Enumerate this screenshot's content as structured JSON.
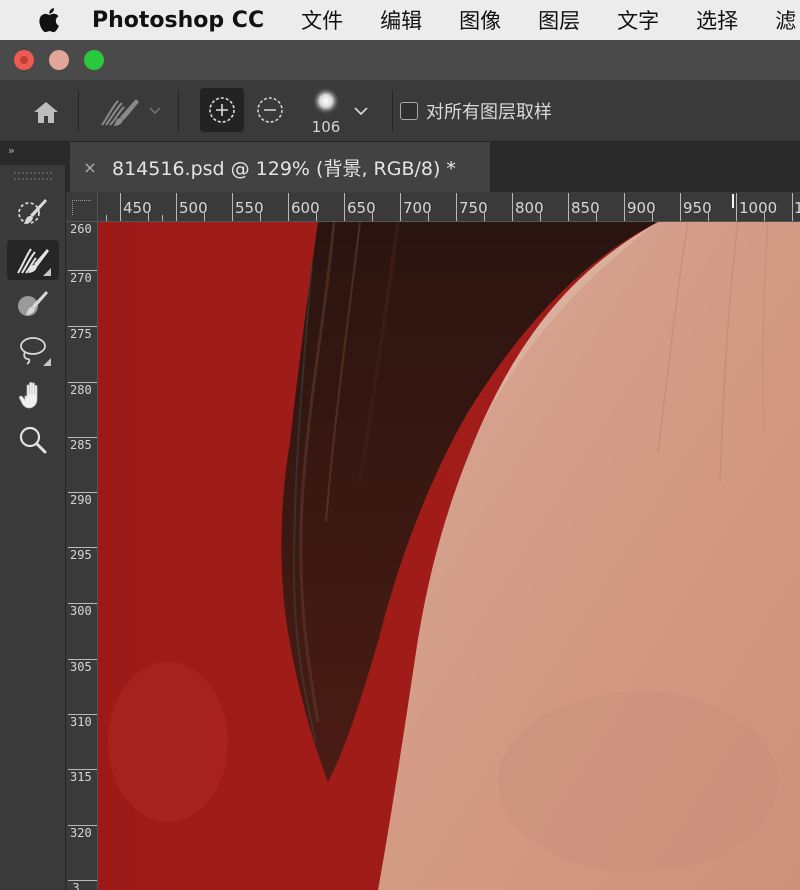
{
  "menubar": {
    "app_name": "Photoshop CC",
    "items": [
      "文件",
      "编辑",
      "图像",
      "图层",
      "文字",
      "选择",
      "滤"
    ]
  },
  "options_bar": {
    "brush_size": "106",
    "sample_all_layers_label": "对所有图层取样",
    "sample_all_layers_checked": false
  },
  "document_tab": {
    "close_glyph": "×",
    "title": "814516.psd @ 129% (背景, RGB/8) *"
  },
  "panel_collapse_glyph": "››",
  "tools": [
    {
      "name": "quick-selection-tool",
      "icon": "quick-selection-icon",
      "active": false
    },
    {
      "name": "refine-edge-brush-tool",
      "icon": "refine-edge-brush-icon",
      "active": true
    },
    {
      "name": "brush-tool",
      "icon": "brush-icon",
      "active": false
    },
    {
      "name": "lasso-tool",
      "icon": "lasso-icon",
      "active": false
    },
    {
      "name": "hand-tool",
      "icon": "hand-icon",
      "active": false
    },
    {
      "name": "zoom-tool",
      "icon": "zoom-icon",
      "active": false
    }
  ],
  "rulers": {
    "horizontal": [
      "450",
      "500",
      "550",
      "600",
      "650",
      "700",
      "750",
      "800",
      "850",
      "900",
      "950",
      "1000",
      "1"
    ],
    "vertical": [
      "260",
      "270",
      "275",
      "280",
      "285",
      "290",
      "295",
      "300",
      "305",
      "310",
      "315",
      "320",
      "3"
    ]
  },
  "colors": {
    "overlay_red": "#9b1a17",
    "skin": "#d69a83",
    "hair": "#2c160f"
  }
}
